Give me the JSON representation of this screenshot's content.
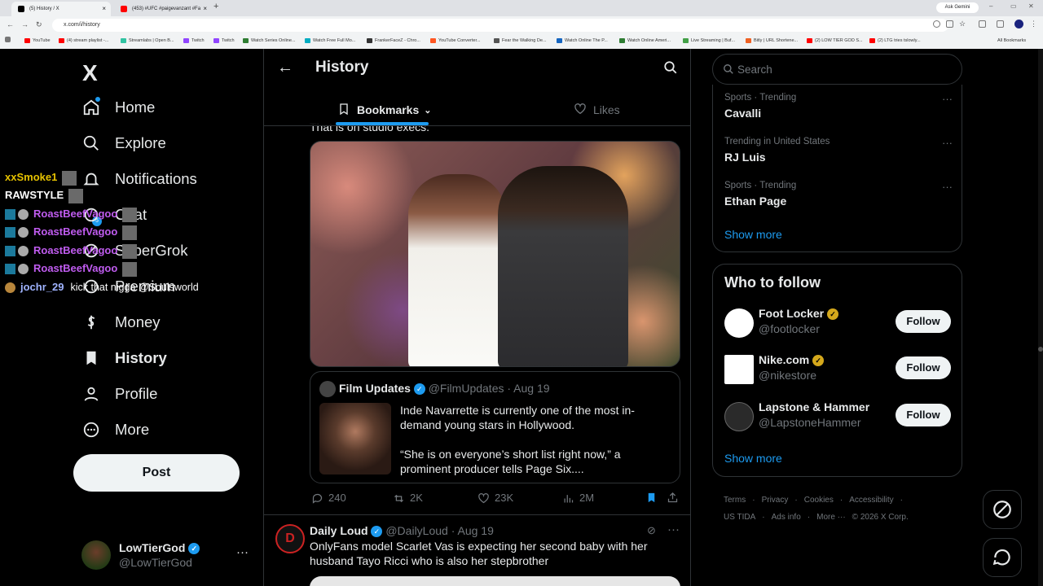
{
  "browser": {
    "tabs": [
      {
        "title": "(5) History / X",
        "close": "×"
      },
      {
        "title": "(453) #UFC #paigevanzant #Fa",
        "close": "×"
      }
    ],
    "new_tab": "+",
    "gemini_label": "Ask Gemini",
    "url": "x.com/i/history",
    "bookmarks": [
      {
        "label": "YouTube",
        "color": "#ff0000"
      },
      {
        "label": "(4) stream playlist -...",
        "color": "#ff0000"
      },
      {
        "label": "Streamlabs | Open B...",
        "color": "#31c3a2"
      },
      {
        "label": "Twitch",
        "color": "#9146ff"
      },
      {
        "label": "Twitch",
        "color": "#9146ff"
      },
      {
        "label": "Watch Series Online...",
        "color": "#2e7d32"
      },
      {
        "label": "Watch Free Full Mo...",
        "color": "#00acc1"
      },
      {
        "label": "FrankerFaceZ - Chro...",
        "color": "#333333"
      },
      {
        "label": "YouTube Converter...",
        "color": "#ff5722"
      },
      {
        "label": "Fear the Walking De...",
        "color": "#555555"
      },
      {
        "label": "Watch Online The P...",
        "color": "#1565c0"
      },
      {
        "label": "Watch Online Ameri...",
        "color": "#2e7d32"
      },
      {
        "label": "Live Streaming | Buf...",
        "color": "#43a047"
      },
      {
        "label": "Bitly | URL Shortene...",
        "color": "#ee6123"
      },
      {
        "label": "(2) LOW TIER GOD S...",
        "color": "#ff0000"
      },
      {
        "label": "(2) LTG tries tslowly...",
        "color": "#ff0000"
      }
    ],
    "all_bookmarks": "All Bookmarks"
  },
  "nav": {
    "logo": "X",
    "items": [
      {
        "label": "Home"
      },
      {
        "label": "Explore"
      },
      {
        "label": "Notifications"
      },
      {
        "label": "Chat"
      },
      {
        "label": "SuperGrok"
      },
      {
        "label": "Premium"
      },
      {
        "label": "Money"
      },
      {
        "label": "History"
      },
      {
        "label": "Profile"
      },
      {
        "label": "More"
      }
    ],
    "notif_count": "5",
    "post_label": "Post",
    "account": {
      "name": "LowTierGod",
      "handle": "@LowTierGod",
      "more": "···"
    }
  },
  "chat_overlay": [
    {
      "user": "xxSmoke1",
      "color": "#e6c200",
      "text": ""
    },
    {
      "user": "RAWSTYLE",
      "color": "#ffffff",
      "text": ""
    },
    {
      "user": "RoastBeefVagoo",
      "color": "#c05cf0",
      "text": ""
    },
    {
      "user": "RoastBeefVagoo",
      "color": "#c05cf0",
      "text": ""
    },
    {
      "user": "RoastBeefVagoo",
      "color": "#c05cf0",
      "text": ""
    },
    {
      "user": "RoastBeefVagoo",
      "color": "#c05cf0",
      "text": ""
    },
    {
      "user": "jochr_29",
      "color": "#9fb3ff",
      "text": "kick that nigga @Soulsworld"
    }
  ],
  "header": {
    "title": "History",
    "tabs": [
      {
        "label": "Bookmarks"
      },
      {
        "label": "Likes"
      }
    ]
  },
  "feed": {
    "prev_text": "That is on studio execs.",
    "post1": {
      "quote": {
        "name": "Film Updates",
        "handle": "@FilmUpdates",
        "date": "· Aug 19",
        "text": "Inde Navarrette is currently one of the most in-demand young stars in Hollywood.\n\n“She is on everyone’s short list right now,” a prominent producer tells Page Six...."
      },
      "stats": {
        "replies": "240",
        "reposts": "2K",
        "likes": "23K",
        "views": "2M"
      }
    },
    "post2": {
      "avatar_letter": "D",
      "name": "Daily Loud",
      "handle": "@DailyLoud",
      "date": "· Aug 19",
      "more": "···",
      "text": "OnlyFans model Scarlet Vas is expecting her second baby with her husband Tayo Ricci who is also her stepbrother"
    }
  },
  "sidebar": {
    "search_placeholder": "Search",
    "trends": [
      {
        "meta": "Sports · Trending",
        "title": "Cavalli",
        "more": "···"
      },
      {
        "meta": "Trending in United States",
        "title": "RJ Luis",
        "more": "···"
      },
      {
        "meta": "Sports · Trending",
        "title": "Ethan Page",
        "more": "···"
      }
    ],
    "show_more": "Show more",
    "who_to_follow": {
      "title": "Who to follow",
      "items": [
        {
          "name": "Foot Locker",
          "handle": "@footlocker",
          "button": "Follow"
        },
        {
          "name": "Nike.com",
          "handle": "@nikestore",
          "button": "Follow"
        },
        {
          "name": "Lapstone & Hammer",
          "handle": "@LapstoneHammer",
          "button": "Follow"
        }
      ],
      "show_more": "Show more"
    },
    "footer": [
      "Terms",
      "·",
      "Privacy",
      "·",
      "Cookies",
      "·",
      "Accessibility",
      "·",
      "US TIDA",
      "·",
      "Ads info",
      "·",
      "More ···",
      "© 2026 X Corp."
    ]
  },
  "colors": {
    "accent": "#1d9bf0",
    "background": "#000000",
    "border": "#2f3336",
    "muted": "#71767b"
  }
}
